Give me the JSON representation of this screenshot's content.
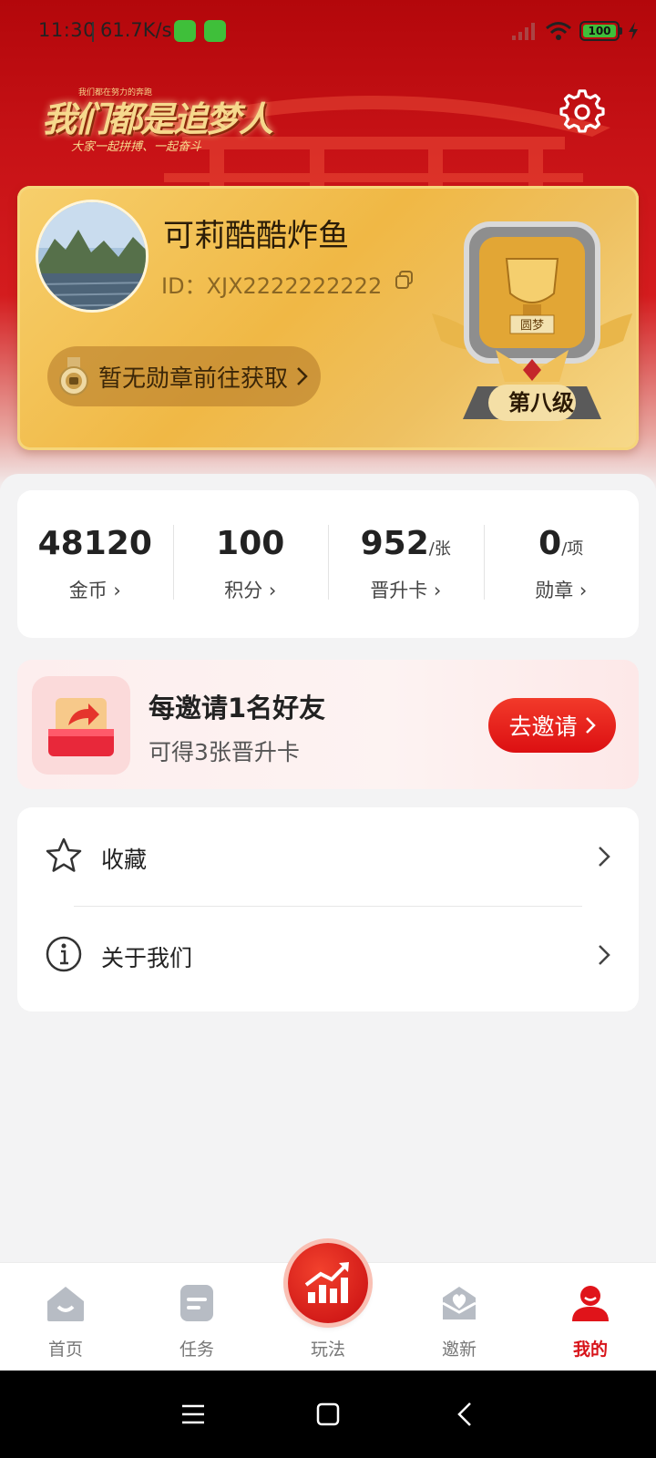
{
  "status_bar": {
    "time": "11:30",
    "speed": "61.7K/s",
    "battery": "100"
  },
  "header": {
    "slogan_small": "我们都在努力的奔跑",
    "slogan_main": "我们都是追梦人",
    "slogan_sub": "大家一起拼搏、一起奋斗",
    "settings_icon": "gear-icon"
  },
  "profile": {
    "username": "可莉酷酷炸鱼",
    "id_text": "ID：XJX2222222222",
    "medal_pill": "暂无勋章前往获取",
    "trophy_plaque": "圆梦",
    "level": "第八级",
    "card_color": "#f0b845"
  },
  "stats": [
    {
      "value": "48120",
      "unit": "",
      "label": "金币"
    },
    {
      "value": "100",
      "unit": "",
      "label": "积分"
    },
    {
      "value": "952",
      "unit": "/张",
      "label": "晋升卡"
    },
    {
      "value": "0",
      "unit": "/项",
      "label": "勋章"
    }
  ],
  "invite": {
    "title": "每邀请1名好友",
    "subtitle": "可得3张晋升卡",
    "button": "去邀请",
    "accent": "#e01414"
  },
  "menu": [
    {
      "label": "收藏",
      "icon": "star-icon"
    },
    {
      "label": "关于我们",
      "icon": "info-icon"
    }
  ],
  "tabs": [
    {
      "label": "首页",
      "icon": "home-icon",
      "active": false
    },
    {
      "label": "任务",
      "icon": "task-icon",
      "active": false
    },
    {
      "label": "玩法",
      "icon": "chart-up-icon",
      "active": false
    },
    {
      "label": "邀新",
      "icon": "invite-icon",
      "active": false
    },
    {
      "label": "我的",
      "icon": "user-icon",
      "active": true
    }
  ],
  "colors": {
    "brand_red": "#d8141a",
    "hero_red": "#c71216",
    "gold": "#f6d98d"
  }
}
